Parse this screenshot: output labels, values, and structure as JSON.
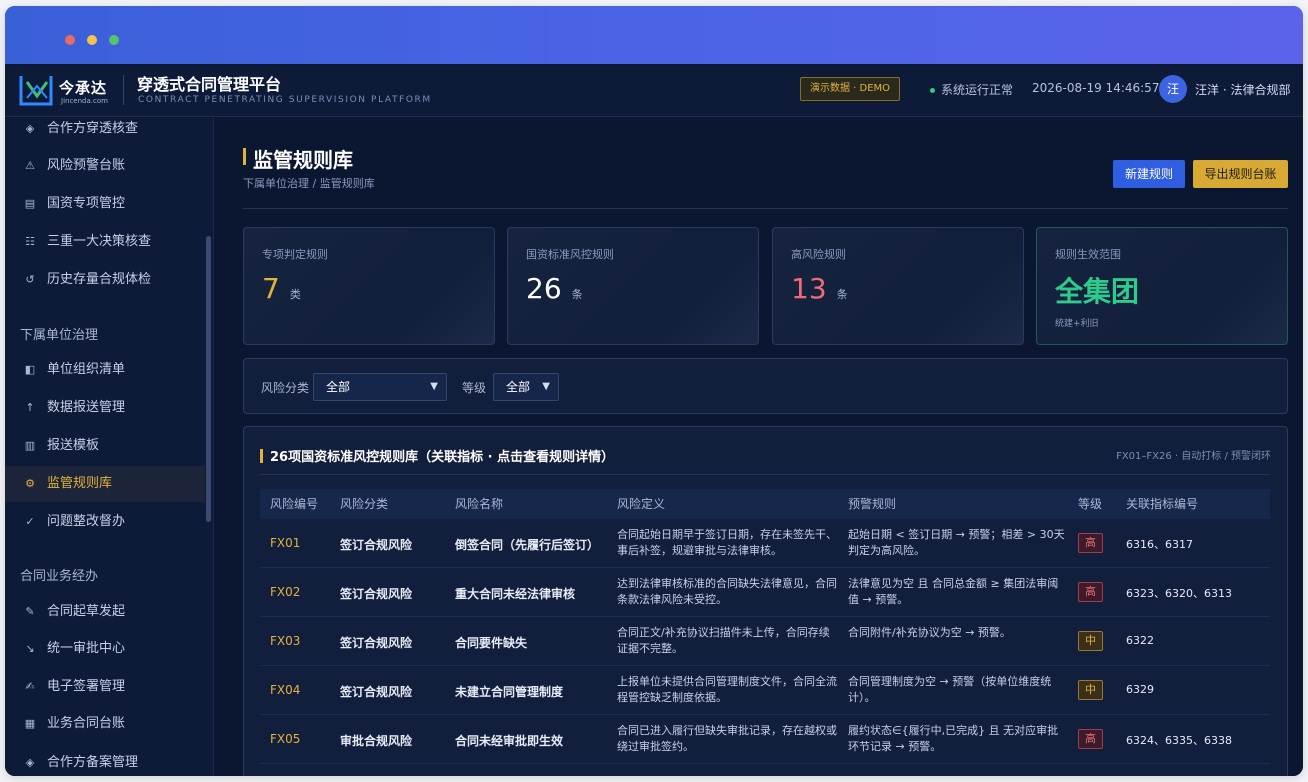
{
  "app": {
    "brand_name": "今承达",
    "brand_sub": "Jincenda.com",
    "title": "穿透式合同管理平台",
    "subtitle": "CONTRACT PENETRATING SUPERVISION PLATFORM",
    "demo_badge": "演示数据 · DEMO",
    "status": "系统运行正常",
    "datetime": "2026-08-19 14:46:57",
    "avatar": "汪",
    "user": "汪洋 · 法律合规部"
  },
  "sidebar": {
    "groups": [
      {
        "label": "下属单位治理"
      },
      {
        "label": "合同业务经办"
      }
    ],
    "items": [
      {
        "label": "合作方穿透核查",
        "icon": "diamond-icon",
        "glyph": "◈"
      },
      {
        "label": "风险预警台账",
        "icon": "warning-icon",
        "glyph": "⚠"
      },
      {
        "label": "国资专项管控",
        "icon": "ledger-icon",
        "glyph": "▤"
      },
      {
        "label": "三重一大决策核查",
        "icon": "group-icon",
        "glyph": "☷"
      },
      {
        "label": "历史存量合规体检",
        "icon": "history-icon",
        "glyph": "↺"
      },
      {
        "label": "单位组织清单",
        "icon": "org-icon",
        "glyph": "◧"
      },
      {
        "label": "数据报送管理",
        "icon": "upload-icon",
        "glyph": "↑"
      },
      {
        "label": "报送模板",
        "icon": "template-icon",
        "glyph": "▥"
      },
      {
        "label": "监管规则库",
        "icon": "gear-icon",
        "glyph": "⚙"
      },
      {
        "label": "问题整改督办",
        "icon": "check-icon",
        "glyph": "✓"
      },
      {
        "label": "合同起草发起",
        "icon": "pen-icon",
        "glyph": "✎"
      },
      {
        "label": "统一审批中心",
        "icon": "arrow-icon",
        "glyph": "↘"
      },
      {
        "label": "电子签署管理",
        "icon": "sign-icon",
        "glyph": "✍"
      },
      {
        "label": "业务合同台账",
        "icon": "table-icon",
        "glyph": "▦"
      },
      {
        "label": "合作方备案管理",
        "icon": "partner-icon",
        "glyph": "◈"
      }
    ]
  },
  "page": {
    "title": "监管规则库",
    "breadcrumb": "下属单位治理 / 监管规则库",
    "btn_new": "新建规则",
    "btn_export": "导出规则台账"
  },
  "stats": [
    {
      "label": "专项判定规则",
      "value": "7",
      "unit": "类",
      "color": "#e3b23c"
    },
    {
      "label": "国资标准风控规则",
      "value": "26",
      "unit": "条",
      "color": "#ffffff"
    },
    {
      "label": "高风险规则",
      "value": "13",
      "unit": "条",
      "color": "#f16a78"
    },
    {
      "label": "规则生效范围",
      "value": "全集团",
      "unit": "",
      "note": "统建+利旧",
      "color": "#2ecc8a"
    }
  ],
  "filters": {
    "category_label": "风险分类",
    "category_value": "全部",
    "level_label": "等级",
    "level_value": "全部"
  },
  "panel": {
    "title": "26项国资标准风控规则库（关联指标 · 点击查看规则详情）",
    "meta": "FX01–FX26 · 自动打标 / 预警闭环",
    "columns": [
      "风险编号",
      "风险分类",
      "风险名称",
      "风险定义",
      "预警规则",
      "等级",
      "关联指标编号"
    ],
    "rows": [
      {
        "code": "FX01",
        "category": "签订合规风险",
        "name": "倒签合同（先履行后签订）",
        "definition": "合同起始日期早于签订日期，存在未签先干、事后补签，规避审批与法律审核。",
        "rule": "起始日期 < 签订日期 → 预警；相差 > 30天判定为高风险。",
        "level": "高",
        "indicators": "6316、6317"
      },
      {
        "code": "FX02",
        "category": "签订合规风险",
        "name": "重大合同未经法律审核",
        "definition": "达到法律审核标准的合同缺失法律意见，合同条款法律风险未受控。",
        "rule": "法律意见为空 且 合同总金额 ≥ 集团法审阈值 → 预警。",
        "level": "高",
        "indicators": "6323、6320、6313"
      },
      {
        "code": "FX03",
        "category": "签订合规风险",
        "name": "合同要件缺失",
        "definition": "合同正文/补充协议扫描件未上传，合同存续证据不完整。",
        "rule": "合同附件/补充协议为空 → 预警。",
        "level": "中",
        "indicators": "6322"
      },
      {
        "code": "FX04",
        "category": "签订合规风险",
        "name": "未建立合同管理制度",
        "definition": "上报单位未提供合同管理制度文件，合同全流程管控缺乏制度依据。",
        "rule": "合同管理制度为空 → 预警（按单位维度统计）。",
        "level": "中",
        "indicators": "6329"
      },
      {
        "code": "FX05",
        "category": "审批合规风险",
        "name": "合同未经审批即生效",
        "definition": "合同已进入履行但缺失审批记录，存在越权或绕过审批签约。",
        "rule": "履约状态∈{履行中,已完成} 且 无对应审批环节记录 → 预警。",
        "level": "高",
        "indicators": "6324、6335、6338"
      }
    ]
  }
}
